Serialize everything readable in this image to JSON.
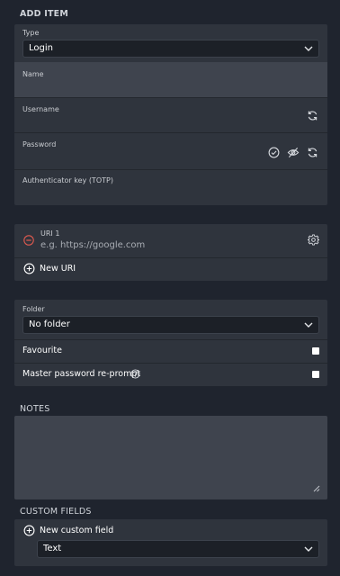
{
  "sections": {
    "add_item": "ADD ITEM",
    "notes": "NOTES",
    "custom_fields": "CUSTOM FIELDS"
  },
  "fields": {
    "type_label": "Type",
    "type_value": "Login",
    "name_label": "Name",
    "username_label": "Username",
    "password_label": "Password",
    "totp_label": "Authenticator key (TOTP)"
  },
  "uris": {
    "uri_label": "URI 1",
    "uri_placeholder": "e.g. https://google.com",
    "new_uri": "New URI"
  },
  "folder": {
    "label": "Folder",
    "value": "No folder",
    "favourite": "Favourite",
    "reprompt": "Master password re-prompt"
  },
  "custom": {
    "new_field": "New custom field",
    "type_value": "Text"
  },
  "colors": {
    "background": "#1f242e",
    "card": "#2f343d",
    "highlight": "#3f444e",
    "remove_icon": "#e05a4f"
  },
  "icons": [
    "chevron-down-icon",
    "refresh-icon",
    "check-circle-icon",
    "eye-slash-icon",
    "remove-circle-icon",
    "gear-icon",
    "add-circle-icon",
    "question-circle-icon"
  ]
}
